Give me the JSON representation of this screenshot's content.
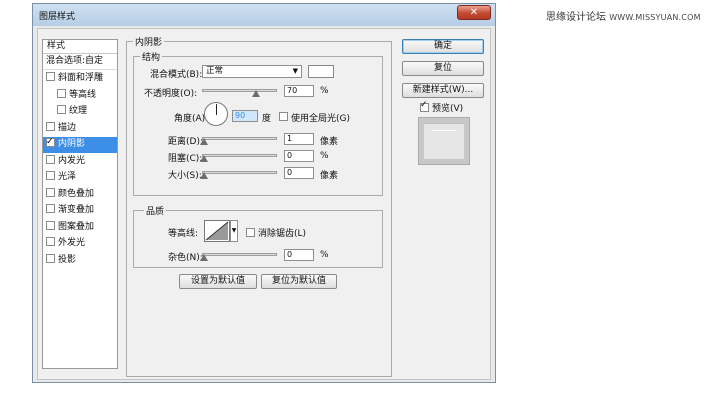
{
  "watermark": {
    "text": "思缘设计论坛",
    "url": "WWW.MISSYUAN.COM"
  },
  "dialog": {
    "title": "图层样式",
    "close_glyph": "✕"
  },
  "style_list": {
    "header": "样式",
    "blend_options": "混合选项:自定",
    "items": [
      {
        "label": "斜面和浮雕",
        "checked": false,
        "indent": 0
      },
      {
        "label": "等高线",
        "checked": false,
        "indent": 1
      },
      {
        "label": "纹理",
        "checked": false,
        "indent": 1
      },
      {
        "label": "描边",
        "checked": false,
        "indent": 0
      },
      {
        "label": "内阴影",
        "checked": true,
        "indent": 0,
        "active": true
      },
      {
        "label": "内发光",
        "checked": false,
        "indent": 0
      },
      {
        "label": "光泽",
        "checked": false,
        "indent": 0
      },
      {
        "label": "颜色叠加",
        "checked": false,
        "indent": 0
      },
      {
        "label": "渐变叠加",
        "checked": false,
        "indent": 0
      },
      {
        "label": "图案叠加",
        "checked": false,
        "indent": 0
      },
      {
        "label": "外发光",
        "checked": false,
        "indent": 0
      },
      {
        "label": "投影",
        "checked": false,
        "indent": 0
      }
    ]
  },
  "inner_shadow": {
    "section_title": "内阴影",
    "structure_title": "结构",
    "blend_mode_label": "混合模式(B):",
    "blend_mode_value": "正常",
    "swatch_color": "#ffffff",
    "opacity_label": "不透明度(O):",
    "opacity_value": "70",
    "opacity_unit": "%",
    "angle_label": "角度(A):",
    "angle_value": "90",
    "angle_unit": "度",
    "global_light_label": "使用全局光(G)",
    "global_light_checked": false,
    "distance_label": "距离(D):",
    "distance_value": "1",
    "distance_unit": "像素",
    "choke_label": "阻塞(C):",
    "choke_value": "0",
    "choke_unit": "%",
    "size_label": "大小(S):",
    "size_value": "0",
    "size_unit": "像素",
    "quality_title": "品质",
    "contour_label": "等高线:",
    "antialias_label": "消除锯齿(L)",
    "antialias_checked": false,
    "noise_label": "杂色(N):",
    "noise_value": "0",
    "noise_unit": "%",
    "make_default_label": "设置为默认值",
    "reset_default_label": "复位为默认值"
  },
  "right_panel": {
    "ok_label": "确定",
    "reset_label": "复位",
    "new_style_label": "新建样式(W)...",
    "preview_label": "预览(V)",
    "preview_checked": true
  },
  "colors": {
    "accent": "#3d8ee6",
    "title_bar": "#c4d7ec",
    "close": "#c44a34"
  }
}
